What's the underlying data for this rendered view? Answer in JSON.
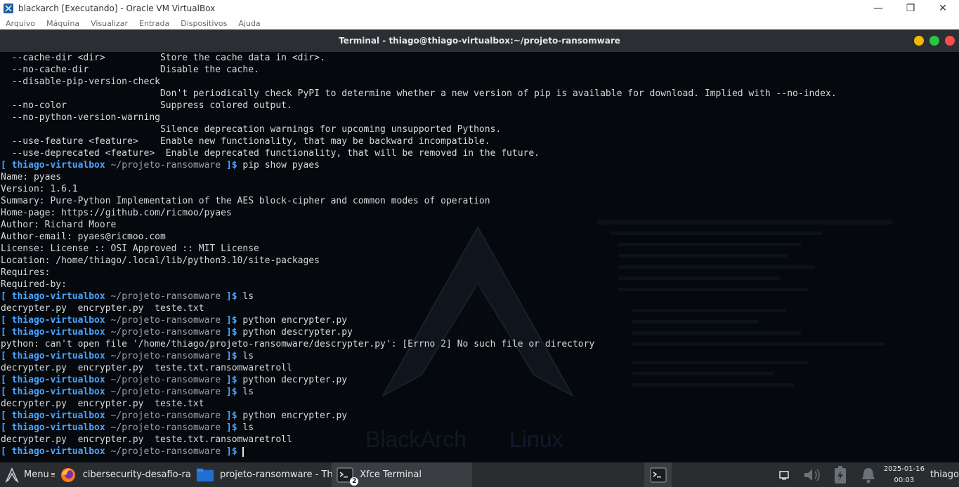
{
  "host": {
    "window_title": "blackarch [Executando] - Oracle VM VirtualBox",
    "menu": [
      "Arquivo",
      "Máquina",
      "Visualizar",
      "Entrada",
      "Dispositivos",
      "Ajuda"
    ],
    "controls": {
      "minimize": "—",
      "restore": "❐",
      "close": "✕"
    }
  },
  "terminal": {
    "title": "Terminal - thiago@thiago-virtualbox:~/projeto-ransomware",
    "dot_colors": [
      "#f5b800",
      "#27c93f",
      "#ff4b4b"
    ],
    "prompt": {
      "open": "[ ",
      "host": "thiago-virtualbox",
      "path": " ~/projeto-ransomware ",
      "close": "]$ "
    },
    "lines": [
      {
        "t": "  --cache-dir <dir>          Store the cache data in <dir>."
      },
      {
        "t": "  --no-cache-dir             Disable the cache."
      },
      {
        "t": "  --disable-pip-version-check"
      },
      {
        "t": "                             Don't periodically check PyPI to determine whether a new version of pip is available for download. Implied with --no-index."
      },
      {
        "t": "  --no-color                 Suppress colored output."
      },
      {
        "t": "  --no-python-version-warning"
      },
      {
        "t": "                             Silence deprecation warnings for upcoming unsupported Pythons."
      },
      {
        "t": "  --use-feature <feature>    Enable new functionality, that may be backward incompatible."
      },
      {
        "t": "  --use-deprecated <feature>  Enable deprecated functionality, that will be removed in the future."
      },
      {
        "p": true,
        "t": "pip show pyaes"
      },
      {
        "t": "Name: pyaes"
      },
      {
        "t": "Version: 1.6.1"
      },
      {
        "t": "Summary: Pure-Python Implementation of the AES block-cipher and common modes of operation"
      },
      {
        "t": "Home-page: https://github.com/ricmoo/pyaes"
      },
      {
        "t": "Author: Richard Moore"
      },
      {
        "t": "Author-email: pyaes@ricmoo.com"
      },
      {
        "t": "License: License :: OSI Approved :: MIT License"
      },
      {
        "t": "Location: /home/thiago/.local/lib/python3.10/site-packages"
      },
      {
        "t": "Requires:"
      },
      {
        "t": "Required-by:"
      },
      {
        "p": true,
        "t": "ls"
      },
      {
        "t": "decrypter.py  encrypter.py  teste.txt"
      },
      {
        "p": true,
        "t": "python encrypter.py"
      },
      {
        "p": true,
        "t": "python descrypter.py"
      },
      {
        "t": "python: can't open file '/home/thiago/projeto-ransomware/descrypter.py': [Errno 2] No such file or directory"
      },
      {
        "p": true,
        "t": "ls"
      },
      {
        "t": "decrypter.py  encrypter.py  teste.txt.ransomwaretroll"
      },
      {
        "p": true,
        "t": "python decrypter.py"
      },
      {
        "p": true,
        "t": "ls"
      },
      {
        "t": "decrypter.py  encrypter.py  teste.txt"
      },
      {
        "p": true,
        "t": "python encrypter.py"
      },
      {
        "p": true,
        "t": "ls"
      },
      {
        "t": "decrypter.py  encrypter.py  teste.txt.ransomwaretroll"
      },
      {
        "p": true,
        "t": "",
        "cursor": true
      }
    ]
  },
  "wallpaper": {
    "brand": "BlackArch",
    "brand_suffix": "Linux"
  },
  "taskbar": {
    "menu_label": "Menu",
    "items": [
      {
        "label": "cibersecurity-desafio-ran...",
        "icon": "firefox-icon"
      },
      {
        "label": "projeto-ransomware - Th...",
        "icon": "folder-icon"
      },
      {
        "label": "Xfce Terminal",
        "icon": "terminal-icon",
        "badge": "2"
      }
    ],
    "date": "2025-01-16",
    "time": "00:03",
    "user": "thiago"
  }
}
